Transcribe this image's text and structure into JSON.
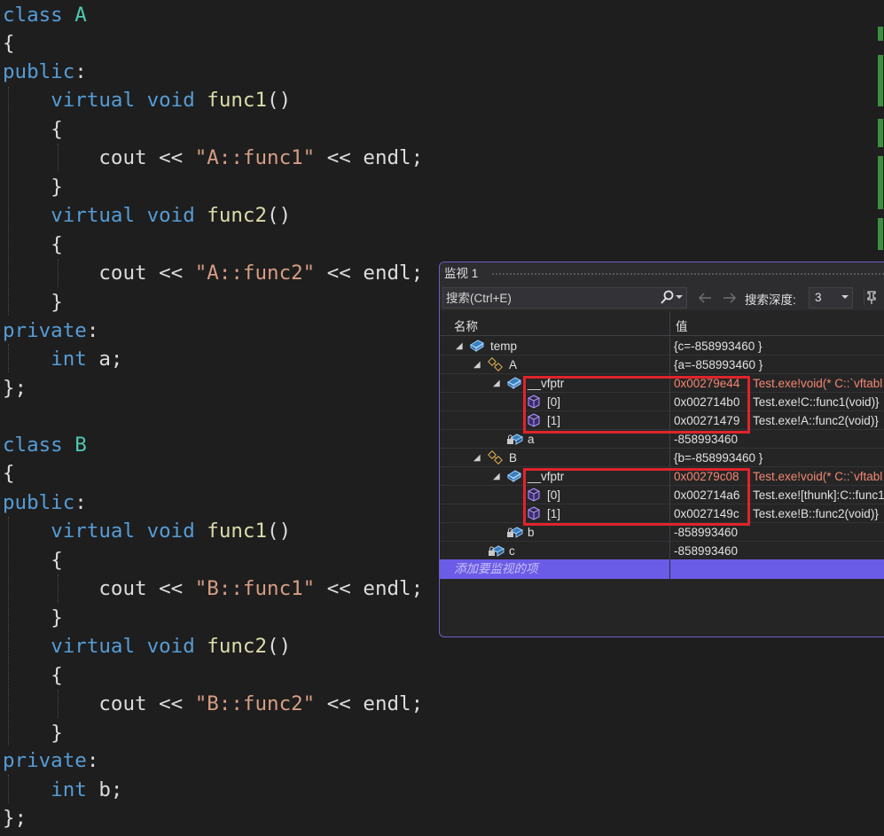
{
  "code": {
    "class_a": {
      "line1_kw": "class",
      "line1_name": "A",
      "brace_open": "{",
      "access_public": "public",
      "colon": ":",
      "virtual": "virtual",
      "void": "void",
      "func1": "func1",
      "func2": "func2",
      "parens": "()",
      "cout": "cout",
      "shift": "<<",
      "str1": "\"A::func1\"",
      "str2": "\"A::func2\"",
      "endl": "endl",
      "semi": ";",
      "access_private": "private",
      "int": "int",
      "member": "a",
      "brace_close": "}",
      "class_end": "};"
    },
    "class_b": {
      "line1_kw": "class",
      "line1_name": "B",
      "str1": "\"B::func1\"",
      "str2": "\"B::func2\"",
      "member": "b"
    }
  },
  "watch": {
    "title": "监视 1",
    "search_placeholder": "搜索(Ctrl+E)",
    "depth_label": "搜索深度:",
    "depth_value": "3",
    "col_name": "名称",
    "col_value": "值",
    "rows": [
      {
        "name": "temp",
        "value": "{c=-858993460 }",
        "type": ""
      },
      {
        "name": "A",
        "value": "{a=-858993460 }",
        "type": ""
      },
      {
        "name": "__vfptr",
        "value": "0x00279e44",
        "type": "Test.exe!void(* C::`vftabl"
      },
      {
        "name": "[0]",
        "value": "0x002714b0",
        "type": "Test.exe!C::func1(void)}"
      },
      {
        "name": "[1]",
        "value": "0x00271479",
        "type": "Test.exe!A::func2(void)}"
      },
      {
        "name": "a",
        "value": "-858993460",
        "type": ""
      },
      {
        "name": "B",
        "value": "{b=-858993460 }",
        "type": ""
      },
      {
        "name": "__vfptr",
        "value": "0x00279c08",
        "type": "Test.exe!void(* C::`vftabl"
      },
      {
        "name": "[0]",
        "value": "0x002714a6",
        "type": "Test.exe![thunk]:C::func1"
      },
      {
        "name": "[1]",
        "value": "0x0027149c",
        "type": "Test.exe!B::func2(void)}"
      },
      {
        "name": "b",
        "value": "-858993460",
        "type": ""
      },
      {
        "name": "c",
        "value": "-858993460",
        "type": ""
      }
    ],
    "add_item": "添加要监视的项"
  },
  "colors": {
    "keyword": "#569cd6",
    "type": "#4ec9b0",
    "function": "#dcdcaa",
    "string": "#d69d85",
    "highlight_red": "#e0242a",
    "watch_accent": "#6b5ce7"
  }
}
